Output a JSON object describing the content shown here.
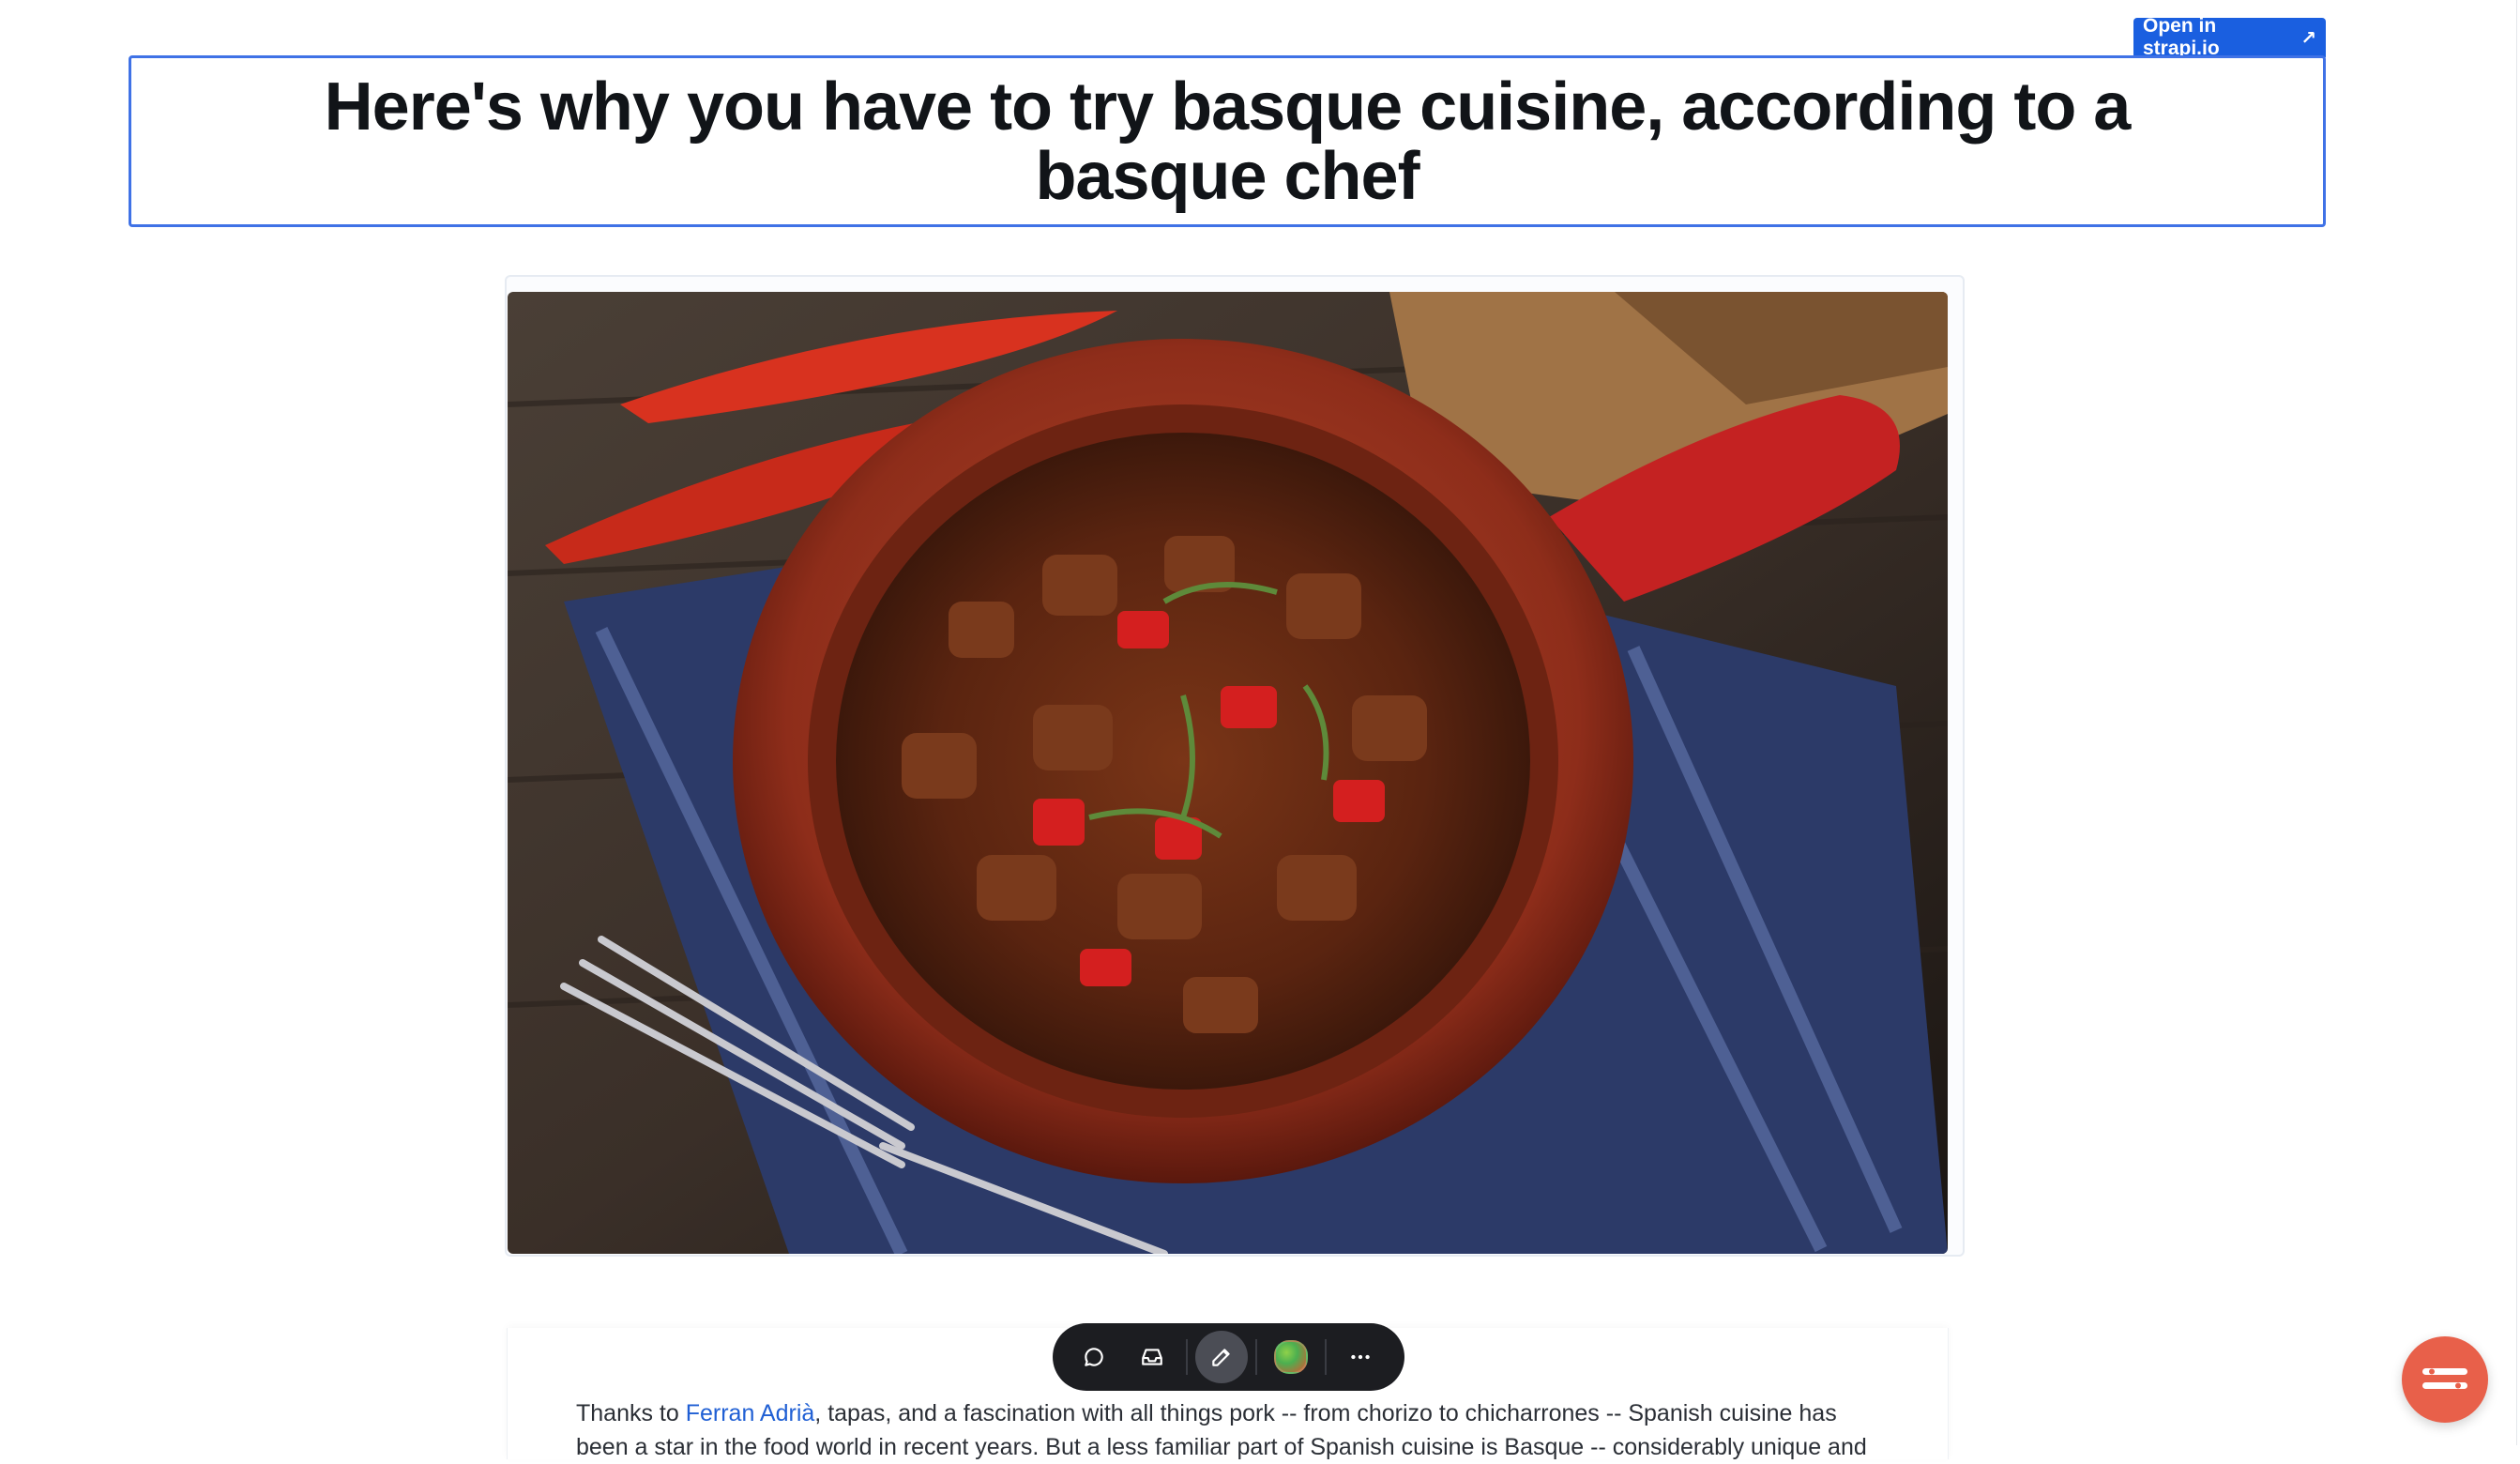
{
  "header": {
    "open_button_label": "Open in strapi.io",
    "open_button_icon": "arrow-up-right-icon"
  },
  "article": {
    "title": "Here's why you have to try basque cuisine, according to a basque chef",
    "image_alt": "Basque stew with peppers in a red clay dish",
    "body": {
      "before_link": "Thanks to ",
      "link_text": "Ferran Adrià",
      "after_link": ", tapas, and a fascination with all things pork -- from chorizo to chicharrones -- Spanish cuisine has",
      "line2": "been a star in the food world in recent years. But a less familiar part of Spanish cuisine is Basque -- considerably unique and"
    }
  },
  "toolbar": {
    "items": [
      "comment-icon",
      "inbox-icon",
      "edit-icon",
      "color-picker",
      "more-icon"
    ],
    "active": "edit-icon"
  },
  "colors": {
    "accent": "#1a5fe0",
    "link": "#1f5fd4",
    "fab": "#e8604a",
    "toolbar_bg": "#1c1d21"
  }
}
